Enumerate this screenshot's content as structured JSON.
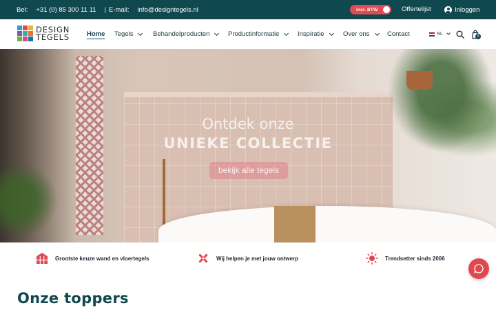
{
  "topbar": {
    "phone_label": "Bel:",
    "phone": "+31 (0) 85 300 11 11",
    "separator": "|",
    "email_label": "E-mail:",
    "email": "info@designtegels.nl",
    "btw_toggle": "incl. BTW",
    "offertelijst": "Offertelijst",
    "login": "Inloggen"
  },
  "brand": {
    "line1": "DESIGN",
    "line2": "TEGELS"
  },
  "nav": {
    "items": [
      {
        "label": "Home"
      },
      {
        "label": "Tegels"
      },
      {
        "label": "Behandelproducten"
      },
      {
        "label": "Productinformatie"
      },
      {
        "label": "Inspiratie"
      },
      {
        "label": "Over ons"
      },
      {
        "label": "Contact"
      }
    ],
    "language": "NL",
    "cart_count": "0"
  },
  "hero": {
    "line1": "Ontdek onze",
    "line2": "UNIEKE COLLECTIE",
    "cta": "bekijk alle tegels"
  },
  "usps": [
    {
      "text": "Grootste keuze wand en vloertegels",
      "icon": "tile-grid-icon"
    },
    {
      "text": "Wij helpen je met jouw ontwerp",
      "icon": "design-tools-icon"
    },
    {
      "text": "Trendsetter sinds 2006",
      "icon": "sun-icon"
    }
  ],
  "section": {
    "title": "Onze toppers"
  },
  "colors": {
    "primary": "#10484f",
    "accent": "#e04a55"
  }
}
